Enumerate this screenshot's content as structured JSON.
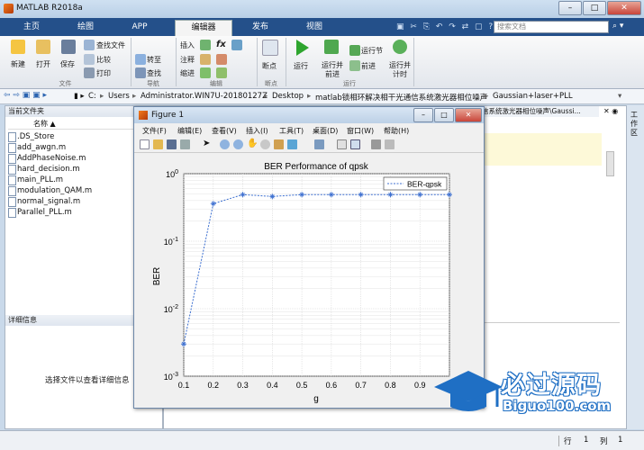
{
  "window": {
    "title": "MATLAB R2018a",
    "min": "–",
    "max": "□",
    "close": "✕"
  },
  "tabs": [
    "主页",
    "绘图",
    "APP",
    "编辑器",
    "发布",
    "视图"
  ],
  "search_placeholder": "搜索文档",
  "ribbon": {
    "file": {
      "new": "新建",
      "open": "打开",
      "save": "保存",
      "find_files": "查找文件",
      "compare": "比较",
      "print": "打印",
      "group": "文件"
    },
    "nav": {
      "goto": "转至",
      "find": "查找",
      "group": "导航"
    },
    "edit": {
      "insert": "插入",
      "comment": "注释",
      "indent": "缩进",
      "fx": "fx",
      "group": "编辑"
    },
    "breakpoints": {
      "label": "断点",
      "group": "断点"
    },
    "run": {
      "run": "运行",
      "run_advance": "运行并\n前进",
      "run_section": "运行节",
      "advance": "前进",
      "run_time": "运行并\n计时",
      "group": "运行"
    }
  },
  "address": [
    "C:",
    "Users",
    "Administrator.WIN7U-20180127Z",
    "Desktop",
    "matlab锁相环解决相干光通信系统激光器相位噪声",
    "Gaussian+laser+PLL"
  ],
  "current_folder": {
    "header": "当前文件夹",
    "col_name": "名称 ▲",
    "files": [
      ".DS_Store",
      "add_awgn.m",
      "AddPhaseNoise.m",
      "hard_decision.m",
      "main_PLL.m",
      "modulation_QAM.m",
      "normal_signal.m",
      "Parallel_PLL.m"
    ]
  },
  "details": {
    "header": "详细信息",
    "placeholder": "选择文件以查看详细信息"
  },
  "editor_tab": "信系统激光器相位噪声\\Gaussi...",
  "workspace_label": "工作区",
  "status": {
    "row_label": "行",
    "row": "1",
    "col_label": "列",
    "col": "1"
  },
  "figure": {
    "title": "Figure 1",
    "menu": [
      "文件(F)",
      "编辑(E)",
      "查看(V)",
      "插入(I)",
      "工具(T)",
      "桌面(D)",
      "窗口(W)",
      "帮助(H)"
    ]
  },
  "watermark": {
    "cn": "必过源码",
    "en": "Biguo100.com"
  },
  "chart_data": {
    "type": "line",
    "title": "BER Performance of qpsk",
    "xlabel": "g",
    "ylabel": "BER",
    "x": [
      0.1,
      0.2,
      0.3,
      0.4,
      0.5,
      0.6,
      0.7,
      0.8,
      0.9,
      1.0
    ],
    "series": [
      {
        "name": "BER-qpsk",
        "values": [
          0.003,
          0.36,
          0.49,
          0.46,
          0.49,
          0.49,
          0.49,
          0.49,
          0.49,
          0.49
        ],
        "color": "#3c6fd0"
      }
    ],
    "xlim": [
      0.1,
      1.0
    ],
    "ylim": [
      0.001,
      1
    ],
    "yscale": "log",
    "xticks": [
      "0.1",
      "0.2",
      "0.3",
      "0.4",
      "0.5",
      "0.6",
      "0.7",
      "0.8",
      "0.9",
      "1"
    ],
    "yticks": [
      "10^{-3}",
      "10^{-2}",
      "10^{-1}",
      "10^{0}"
    ],
    "grid": true,
    "legend_position": "top-right"
  }
}
